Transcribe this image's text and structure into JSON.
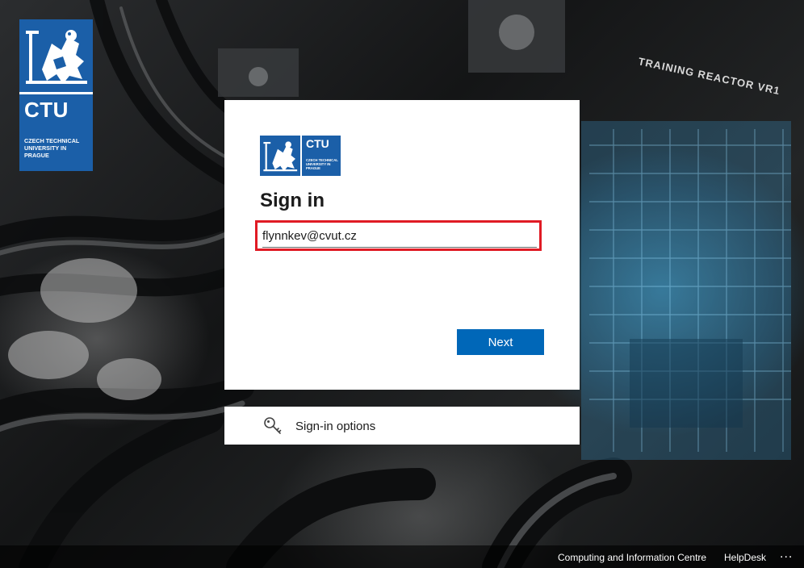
{
  "brand": {
    "acronym": "CTU",
    "subtitle": "CZECH TECHNICAL UNIVERSITY IN PRAGUE"
  },
  "background": {
    "sign_text": "TRAINING REACTOR VR1"
  },
  "card": {
    "logo_acronym": "CTU",
    "logo_subtitle": "CZECH TECHNICAL UNIVERSITY IN PRAGUE",
    "title": "Sign in",
    "email_value": "flynnkev@cvut.cz",
    "next_label": "Next"
  },
  "options": {
    "label": "Sign-in options",
    "icon": "key-icon"
  },
  "footer": {
    "link1": "Computing and Information Centre",
    "link2": "HelpDesk",
    "more": "..."
  },
  "colors": {
    "brand_blue": "#1b5fa8",
    "button_blue": "#0067b8",
    "highlight_red": "#e01b24"
  }
}
